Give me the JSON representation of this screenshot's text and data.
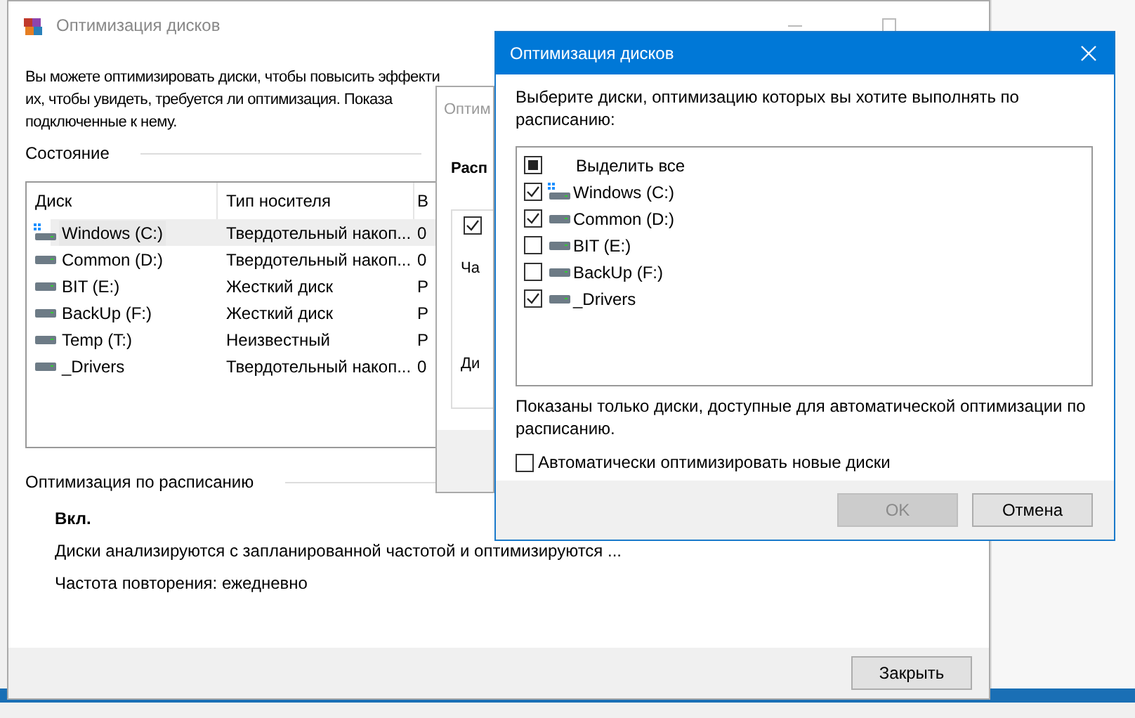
{
  "main_window": {
    "title": "Оптимизация дисков",
    "intro_lines": [
      "Вы можете оптимизировать диски, чтобы повысить эффекти",
      "их, чтобы увидеть, требуется ли оптимизация. Показа",
      "подключенные к нему."
    ],
    "status_label": "Состояние",
    "table": {
      "columns": [
        "Диск",
        "Тип носителя",
        "В"
      ],
      "rows": [
        {
          "name": "Windows (C:)",
          "kind": "system",
          "media": "Твердотельный накоп...",
          "column_3": "0",
          "selected": true
        },
        {
          "name": "Common (D:)",
          "kind": "drive",
          "media": "Твердотельный накоп...",
          "column_3": "0",
          "selected": false
        },
        {
          "name": "BIT (E:)",
          "kind": "drive",
          "media": "Жесткий диск",
          "column_3": "Р",
          "selected": false
        },
        {
          "name": "BackUp (F:)",
          "kind": "drive",
          "media": "Жесткий диск",
          "column_3": "Р",
          "selected": false
        },
        {
          "name": "Temp (T:)",
          "kind": "drive",
          "media": "Неизвестный",
          "column_3": "Р",
          "selected": false
        },
        {
          "name": "_Drivers",
          "kind": "drive",
          "media": "Твердотельный накоп...",
          "column_3": "0",
          "selected": false
        }
      ]
    },
    "schedule_label": "Оптимизация по расписанию",
    "schedule_state": "Вкл.",
    "schedule_description": "Диски анализируются с запланированной частотой и оптимизируются ...",
    "frequency": "Частота повторения: ежедневно",
    "close_button": "Закрыть"
  },
  "middle_window": {
    "title": "Оптим",
    "heading": "Расп",
    "checked": true,
    "labels": [
      "Ча",
      "Ди"
    ]
  },
  "dialog": {
    "title": "Оптимизация дисков",
    "prompt": "Выберите диски, оптимизацию которых вы хотите выполнять по расписанию:",
    "select_all": {
      "label": "Выделить все",
      "indeterminate": true
    },
    "items": [
      {
        "label": "Windows (C:)",
        "kind": "system",
        "checked": true
      },
      {
        "label": "Common (D:)",
        "kind": "drive",
        "checked": true
      },
      {
        "label": "BIT (E:)",
        "kind": "drive",
        "checked": false
      },
      {
        "label": "BackUp (F:)",
        "kind": "drive",
        "checked": false
      },
      {
        "label": "_Drivers",
        "kind": "drive",
        "checked": true
      }
    ],
    "note": "Показаны только диски, доступные для автоматической оптимизации по расписанию.",
    "auto_option": {
      "label": "Автоматически оптимизировать новые диски",
      "checked": false
    },
    "buttons": [
      {
        "label": "OK",
        "disabled": true
      },
      {
        "label": "Отмена",
        "disabled": false
      }
    ]
  }
}
